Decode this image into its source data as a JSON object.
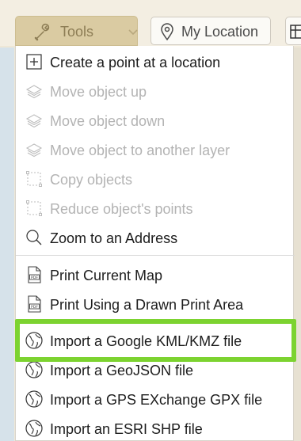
{
  "toolbar": {
    "tools_label": "Tools",
    "location_label": "My Location"
  },
  "menu": {
    "items": [
      {
        "label": "Create a point at a location",
        "icon": "plus-box-icon",
        "enabled": true
      },
      {
        "label": "Move object up",
        "icon": "layers-icon",
        "enabled": false
      },
      {
        "label": "Move object down",
        "icon": "layers-icon",
        "enabled": false
      },
      {
        "label": "Move object to another layer",
        "icon": "layers-icon",
        "enabled": false
      },
      {
        "label": "Copy objects",
        "icon": "dashed-square-icon",
        "enabled": false
      },
      {
        "label": "Reduce object's points",
        "icon": "dashed-square-icon",
        "enabled": false
      },
      {
        "label": "Zoom to an Address",
        "icon": "magnifier-icon",
        "enabled": true
      },
      {
        "label": "Print Current Map",
        "icon": "pdf-icon",
        "enabled": true
      },
      {
        "label": "Print Using a Drawn Print Area",
        "icon": "pdf-icon",
        "enabled": true
      },
      {
        "label": "Import a Google KML/KMZ file",
        "icon": "globe-icon",
        "enabled": true,
        "highlighted": true
      },
      {
        "label": "Import a GeoJSON file",
        "icon": "globe-icon",
        "enabled": true
      },
      {
        "label": "Import a GPS EXchange GPX file",
        "icon": "globe-icon",
        "enabled": true
      },
      {
        "label": "Import an ESRI SHP file",
        "icon": "globe-icon",
        "enabled": true
      }
    ]
  },
  "colors": {
    "highlight": "#7cd330",
    "tools_button": "#dacba2",
    "disabled_text": "#b3b3b3"
  }
}
